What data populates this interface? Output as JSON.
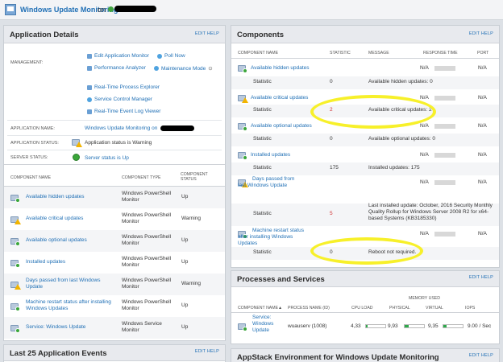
{
  "header": {
    "title": "Windows Update Monitoring",
    "on": "on"
  },
  "application_details": {
    "title": "Application Details",
    "edit_help": "EDIT HELP",
    "management_label": "MANAGEMENT:",
    "management_items": [
      "Edit Application Monitor",
      "Poll Now",
      "Performance Analyzer",
      "Maintenance Mode",
      "Real-Time Process Explorer",
      "Service Control Manager",
      "Real-Time Event Log Viewer"
    ],
    "app_name_label": "APPLICATION NAME:",
    "app_name_value": "Windows Update Monitoring on",
    "app_status_label": "APPLICATION STATUS:",
    "app_status_value": "Application status is Warning",
    "server_status_label": "SERVER STATUS:",
    "server_status_value": "Server status is Up",
    "table_headers": [
      "COMPONENT NAME",
      "COMPONENT TYPE",
      "COMPONENT STATUS"
    ],
    "components": [
      {
        "name": "Available hidden updates",
        "type": "Windows PowerShell Monitor",
        "status": "Up"
      },
      {
        "name": "Available critical updates",
        "type": "Windows PowerShell Monitor",
        "status": "Warning"
      },
      {
        "name": "Available optional updates",
        "type": "Windows PowerShell Monitor",
        "status": "Up"
      },
      {
        "name": "Installed updates",
        "type": "Windows PowerShell Monitor",
        "status": "Up"
      },
      {
        "name": "Days passed from last Windows Update",
        "type": "Windows PowerShell Monitor",
        "status": "Warning"
      },
      {
        "name": "Machine restart status after installing Windows Updates",
        "type": "Windows PowerShell Monitor",
        "status": "Up"
      },
      {
        "name": "Service: Windows Update",
        "type": "Windows Service Monitor",
        "status": "Up"
      }
    ]
  },
  "events": {
    "title": "Last 25 Application Events",
    "edit_help": "EDIT HELP"
  },
  "components_panel": {
    "title": "Components",
    "edit_help": "EDIT HELP",
    "headers": [
      "COMPONENT NAME",
      "STATISTIC",
      "MESSAGE",
      "RESPONSE TIME",
      "PORT"
    ],
    "statistic_label": "Statistic",
    "na": "N/A",
    "rows": [
      {
        "name": "Available hidden updates",
        "stat": "0",
        "message": "Available hidden updates: 0"
      },
      {
        "name": "Available critical updates",
        "stat": "2",
        "message": "Available critical updates: 2"
      },
      {
        "name": "Available optional updates",
        "stat": "0",
        "message": "Available optional updates: 0"
      },
      {
        "name": "Installed updates",
        "stat": "175",
        "message": "Installed updates: 175"
      },
      {
        "name": "Days passed from last Windows Update",
        "stat": "5",
        "message": "Last installed update: October, 2016 Security Monthly Quality Rollup for Windows Server 2008 R2 for x64-based Systems (KB3185330)"
      },
      {
        "name": "Machine restart status after installing Windows Updates",
        "stat": "0",
        "message": "Reboot not required."
      }
    ]
  },
  "processes": {
    "title": "Processes and Services",
    "edit_help": "EDIT HELP",
    "memory_used": "MEMORY USED",
    "headers": [
      "COMPONENT NAME",
      "PROCESS NAME (ID)",
      "CPU LOAD",
      "PHYSICAL",
      "VIRTUAL",
      "IOPS"
    ],
    "sort_arrow": "▲",
    "row": {
      "name": "Service: Windows Update",
      "process": "wuauserv (1008)",
      "cpu": "4,33",
      "physical": "9,93",
      "virtual": "9,35",
      "iops": "9.00 / Sec"
    },
    "levels": {
      "cpu": 0.1,
      "physical": 0.2,
      "virtual": 0.15
    }
  },
  "appstack": {
    "title": "AppStack Environment for Windows Update Monitoring",
    "edit_help": "EDIT HELP"
  },
  "colors": {
    "link": "#1f6fb5",
    "warning": "#f2b400",
    "up": "#3aa63a",
    "highlight": "#f7f02a"
  }
}
